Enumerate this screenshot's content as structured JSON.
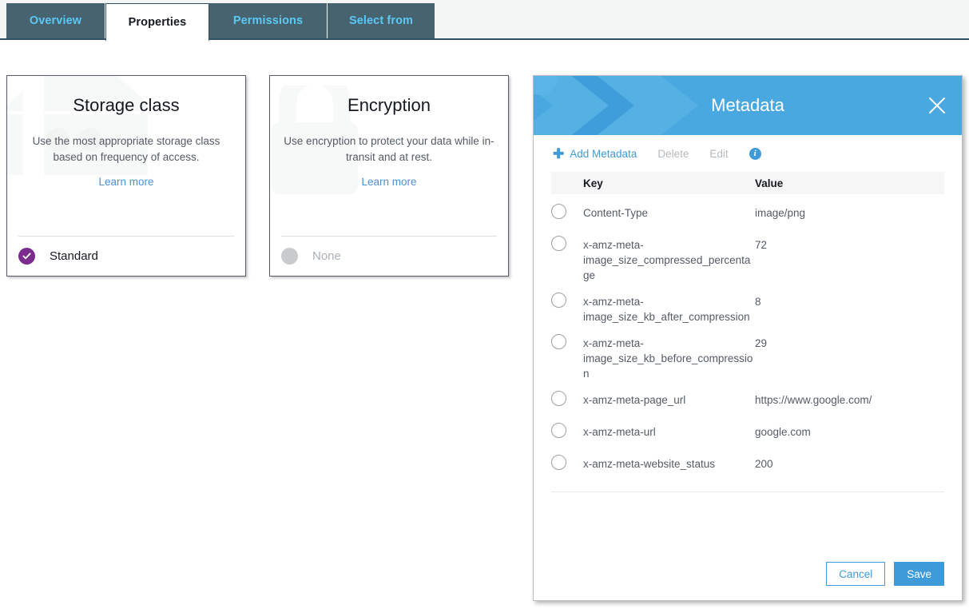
{
  "tabs": [
    {
      "id": "overview",
      "label": "Overview",
      "active": false
    },
    {
      "id": "properties",
      "label": "Properties",
      "active": true
    },
    {
      "id": "permissions",
      "label": "Permissions",
      "active": false
    },
    {
      "id": "selectfrom",
      "label": "Select from",
      "active": false
    }
  ],
  "cards": {
    "storage": {
      "title": "Storage class",
      "description": "Use the most appropriate storage class based on frequency of access.",
      "link": "Learn more",
      "watermark": "archive-box-icon",
      "status": "Standard",
      "status_state": "selected",
      "accent": "#7b2d8e"
    },
    "encryption": {
      "title": "Encryption",
      "description": "Use encryption to protect your data while in-transit and at rest.",
      "link": "Learn more",
      "watermark": "padlock-icon",
      "status": "None",
      "status_state": "muted",
      "accent": "#c8cacc"
    }
  },
  "metadata_panel": {
    "title": "Metadata",
    "close_icon": "close-icon",
    "header_color": "#4aa8e0",
    "toolbar": {
      "add_label": "Add Metadata",
      "add_icon": "plus-icon",
      "delete_label": "Delete",
      "edit_label": "Edit",
      "info_icon": "info-icon",
      "info_glyph": "i"
    },
    "table": {
      "headers": {
        "key": "Key",
        "value": "Value"
      },
      "rows": [
        {
          "key": "Content-Type",
          "value": "image/png"
        },
        {
          "key": "x-amz-meta-image_size_compressed_percentage",
          "value": "72"
        },
        {
          "key": "x-amz-meta-image_size_kb_after_compression",
          "value": "8"
        },
        {
          "key": "x-amz-meta-image_size_kb_before_compression",
          "value": "29"
        },
        {
          "key": "x-amz-meta-page_url",
          "value": "https://www.google.com/"
        },
        {
          "key": "x-amz-meta-url",
          "value": "google.com"
        },
        {
          "key": "x-amz-meta-website_status",
          "value": "200"
        }
      ]
    },
    "buttons": {
      "cancel": "Cancel",
      "save": "Save"
    }
  }
}
